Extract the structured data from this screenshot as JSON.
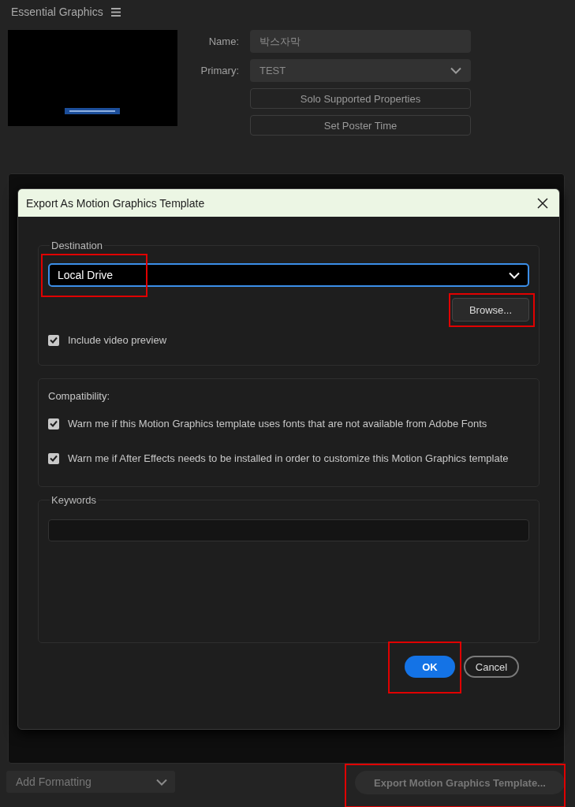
{
  "panel": {
    "title": "Essential Graphics"
  },
  "template": {
    "name_label": "Name:",
    "name_value": "박스자막",
    "primary_label": "Primary:",
    "primary_value": "TEST",
    "buttons": [
      "Solo Supported Properties",
      "Set Poster Time"
    ]
  },
  "dialog": {
    "title": "Export As Motion Graphics Template",
    "destination": {
      "legend": "Destination",
      "value": "Local Drive",
      "browse": "Browse...",
      "preview": {
        "label": "Include video preview",
        "checked": true
      }
    },
    "compatibility": {
      "label": "Compatibility:",
      "options": [
        {
          "label": "Warn me if this Motion Graphics template uses fonts that are not available from Adobe Fonts",
          "checked": true
        },
        {
          "label": "Warn me if After Effects needs to be installed in order to customize this Motion Graphics template",
          "checked": true
        }
      ]
    },
    "keywords": {
      "legend": "Keywords"
    },
    "buttons": [
      {
        "label": "OK",
        "kind": "primary"
      },
      {
        "label": "Cancel",
        "kind": "secondary"
      }
    ]
  },
  "footer": {
    "add_formatting": "Add Formatting",
    "export": "Export Motion Graphics Template..."
  }
}
